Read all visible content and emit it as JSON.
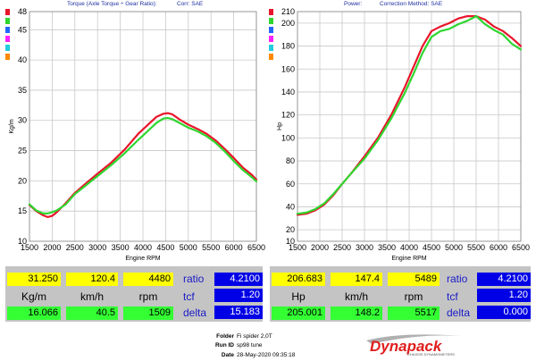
{
  "colors": {
    "run_a": "#e8152a",
    "run_b": "#2fd62f",
    "yellow_cell": "#ffff00",
    "green_cell": "#33ff33",
    "blue_box": "#0000e6",
    "grid": "#c8c8c8",
    "readout_bg": "#c4c4c4",
    "title_text": "#1c2fa0",
    "logo_red": "#e01e1e"
  },
  "swatch_colors": [
    "#e8152a",
    "#2fd62f",
    "#2266ff",
    "#ff22ff",
    "#22ccdd",
    "#ff8800"
  ],
  "left_panel": {
    "title": "Torque (Axle Torque ÷ Gear Ratio):",
    "correction": "Corr: SAE",
    "readout": {
      "run_a": {
        "value": "31.250",
        "speed": "120.4",
        "rpm": "4480"
      },
      "units": {
        "value": "Kg/m",
        "speed": "km/h",
        "rpm": "rpm"
      },
      "run_b": {
        "value": "16.066",
        "speed": "40.5",
        "rpm": "1509"
      },
      "ratio_label": "ratio",
      "ratio": "4.2100",
      "tcf_label": "tcf",
      "tcf": "1.20",
      "delta_label": "delta",
      "delta": "15.183"
    }
  },
  "right_panel": {
    "title": "Power:",
    "correction": "Correction Method: SAE",
    "readout": {
      "run_a": {
        "value": "206.683",
        "speed": "147.4",
        "rpm": "5489"
      },
      "units": {
        "value": "Hp",
        "speed": "km/h",
        "rpm": "rpm"
      },
      "run_b": {
        "value": "205.001",
        "speed": "148.2",
        "rpm": "5517"
      },
      "ratio_label": "ratio",
      "ratio": "4.2100",
      "tcf_label": "tcf",
      "tcf": "1.20",
      "delta_label": "delta",
      "delta": "0.000"
    }
  },
  "info": {
    "folder_label": "Folder",
    "folder": "Fi spider 2,0T",
    "run_label": "Run ID",
    "run": "sp98 tune",
    "date_label": "Date",
    "date": "28-May-2020 09:35:18"
  },
  "logo": {
    "text": "Dynapack",
    "tagline": "CHASSIS DYNAMOMETERS"
  },
  "chart_data": [
    {
      "type": "line",
      "title": "Torque (Axle Torque ÷ Gear Ratio):",
      "xlabel": "Engine RPM",
      "ylabel": "Kg/m",
      "xlim": [
        1500,
        6500
      ],
      "ylim": [
        10,
        48
      ],
      "xticks": [
        1500,
        2000,
        2500,
        3000,
        3500,
        4000,
        4500,
        5000,
        5500,
        6000,
        6500
      ],
      "yticks": [
        10,
        15,
        20,
        25,
        30,
        35,
        40,
        45,
        48
      ],
      "grid": true,
      "series": [
        {
          "color": "#e8152a",
          "x": [
            1500,
            1650,
            1800,
            1900,
            2000,
            2100,
            2300,
            2500,
            2700,
            3000,
            3300,
            3600,
            3900,
            4100,
            4300,
            4450,
            4550,
            4650,
            4800,
            5000,
            5200,
            5400,
            5600,
            5800,
            6000,
            6200,
            6400,
            6500
          ],
          "y": [
            16.0,
            15.0,
            14.3,
            14.0,
            14.2,
            14.8,
            16.3,
            18.0,
            19.3,
            21.2,
            23.0,
            25.2,
            27.8,
            29.2,
            30.6,
            31.1,
            31.2,
            31.0,
            30.2,
            29.3,
            28.6,
            27.8,
            26.7,
            25.3,
            23.8,
            22.2,
            21.0,
            20.2
          ]
        },
        {
          "color": "#2fd62f",
          "x": [
            1500,
            1650,
            1800,
            1900,
            2000,
            2100,
            2300,
            2500,
            2700,
            3000,
            3300,
            3600,
            3900,
            4100,
            4300,
            4450,
            4550,
            4650,
            4800,
            5000,
            5200,
            5400,
            5600,
            5800,
            6000,
            6200,
            6400,
            6500
          ],
          "y": [
            16.1,
            15.1,
            14.6,
            14.6,
            14.8,
            15.1,
            16.1,
            17.8,
            19.0,
            20.8,
            22.6,
            24.6,
            26.8,
            28.2,
            29.6,
            30.3,
            30.4,
            30.2,
            29.6,
            28.8,
            28.2,
            27.4,
            26.3,
            24.9,
            23.3,
            21.8,
            20.6,
            19.9
          ]
        }
      ]
    },
    {
      "type": "line",
      "title": "Power:",
      "xlabel": "Engine RPM",
      "ylabel": "Hp",
      "xlim": [
        1500,
        6500
      ],
      "ylim": [
        10,
        210
      ],
      "xticks": [
        1500,
        2000,
        2500,
        3000,
        3500,
        4000,
        4500,
        5000,
        5500,
        6000,
        6500
      ],
      "yticks": [
        10,
        20,
        40,
        60,
        80,
        100,
        120,
        140,
        160,
        180,
        200,
        210
      ],
      "grid": true,
      "series": [
        {
          "color": "#e8152a",
          "x": [
            1500,
            1700,
            1900,
            2100,
            2300,
            2500,
            2700,
            3000,
            3300,
            3600,
            3900,
            4100,
            4300,
            4500,
            4700,
            4900,
            5100,
            5300,
            5500,
            5700,
            5900,
            6100,
            6300,
            6500
          ],
          "y": [
            33,
            34,
            37,
            42,
            50,
            60,
            69,
            84,
            100,
            120,
            144,
            162,
            180,
            193,
            197,
            200,
            204,
            206,
            206,
            203,
            197,
            193,
            187,
            180
          ]
        },
        {
          "color": "#2fd62f",
          "x": [
            1500,
            1700,
            1900,
            2100,
            2300,
            2500,
            2700,
            3000,
            3300,
            3600,
            3900,
            4100,
            4300,
            4500,
            4700,
            4900,
            5100,
            5300,
            5500,
            5700,
            5900,
            6100,
            6300,
            6500
          ],
          "y": [
            34,
            35,
            38,
            43,
            51,
            60,
            69,
            82,
            98,
            117,
            139,
            156,
            174,
            188,
            193,
            195,
            199,
            202,
            206,
            199,
            194,
            190,
            182,
            177
          ]
        }
      ]
    }
  ]
}
